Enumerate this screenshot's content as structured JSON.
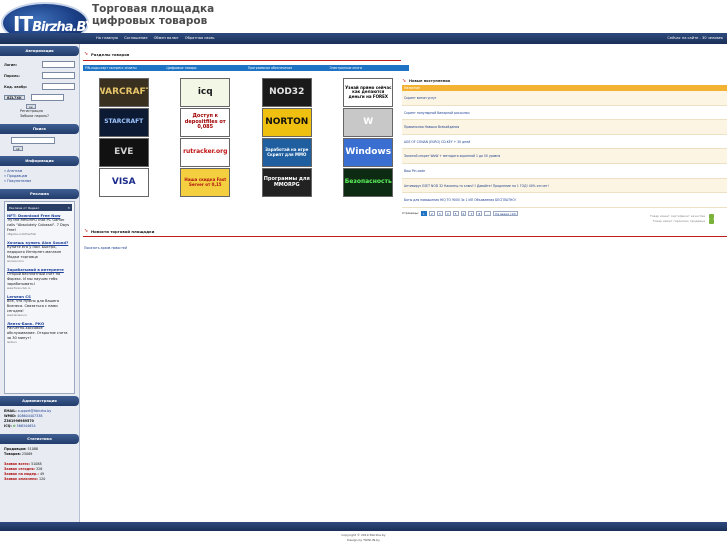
{
  "header": {
    "logo_main": "IT",
    "logo_tail": "Birzha.BY",
    "slogan_line1": "Торговая площадка",
    "slogan_line2": "цифровых товаров"
  },
  "topnav": {
    "items": [
      "На главную",
      "Соглашение",
      "Обмен валют",
      "Обратная связь"
    ],
    "online": "Сейчас на сайте - 30 человек"
  },
  "sidebar": {
    "auth_title": "Авторизация",
    "login_label": "Логин:",
    "password_label": "Пароль:",
    "code_label": "Код. изобр:",
    "captcha_text": "8ZL7XK",
    "submit_label": "ок",
    "register_link": "Регистрация",
    "forgot_link": "Забыли пароль?",
    "search_title": "Поиск",
    "search_button": "ok",
    "info_title": "Информация",
    "info_links": [
      "Агентам",
      "Продавцам",
      "Покупателям"
    ],
    "ads_title": "Реклама",
    "ads_head": "Реклама от Яндекс",
    "ads": [
      {
        "title": "NFT: Download Free Now",
        "text": "Try the MMORPG that PC Gamer calls \"Absolutely Colossal\". 7 Days Free!",
        "url": "nftgame.com/FreeTrial"
      },
      {
        "title": "Хочешь купить Alon Sound?",
        "text": "Купите его у нас! Быстро, недорого Интернет-магазин Модки торговца",
        "url": "alonsound.ru"
      },
      {
        "title": "Зарабатывай в интернете",
        "text": "Открой бесплатный счет на Форекс. И мы научим тебя зарабатывать!",
        "url": "www.forex-club.ru"
      },
      {
        "title": "Lersean CS",
        "text": "Все, что нужно для Вашего бизнеса. Связаться с нами сегодня!",
        "url": "www.lersean.ru"
      },
      {
        "title": "Лента-Банк. РКО",
        "text": "Расчетно-кассовое обслуживание. Открытие счета за 30 минут!",
        "url": "lenta.ru"
      }
    ],
    "admin_title": "Администрация",
    "admin": [
      {
        "label": "EMAIL:",
        "value": "support@itbirzha.by"
      },
      {
        "label": "WMID:",
        "value": "408604407338"
      },
      {
        "label": "Z:",
        "value": "Z361996989570"
      },
      {
        "label": "ICQ:",
        "value": "566344654"
      }
    ],
    "stats_title": "Статистика",
    "stats": [
      {
        "label": "Продавцов:",
        "value": "51088",
        "red": false
      },
      {
        "label": "Товаров:",
        "value": "25069",
        "red": false
      },
      {
        "label": "Заявок всего:",
        "value": "51088",
        "red": true
      },
      {
        "label": "Заявок сегодня:",
        "value": "326",
        "red": true
      },
      {
        "label": "Заявок на модер.:",
        "value": "49",
        "red": true
      },
      {
        "label": "Заявок оплачено:",
        "value": "120",
        "red": true
      }
    ]
  },
  "main": {
    "sections_title": "Разделы товаров",
    "categories": [
      "PIN-коды карт экспресс оплаты",
      "Цифровые товары",
      "Программное обеспечение",
      "Электронные книги"
    ],
    "banners": [
      {
        "text": "WARCRAFT",
        "bg": "#3a3020",
        "fg": "#e7c66a"
      },
      {
        "text": "icq",
        "bg": "#f2f7e6",
        "fg": "#1a1a1a"
      },
      {
        "text": "NOD32",
        "bg": "#1a1a1a",
        "fg": "#e6e6e6"
      },
      {
        "text": "Узнай прямо сейчас как делаются деньги на FOREX",
        "bg": "#ffffff",
        "fg": "#000000"
      },
      {
        "text": "STARCRAFT",
        "bg": "#0d1a33",
        "fg": "#9cc5ff"
      },
      {
        "text": "Доступ к depositfiles от 0,085",
        "bg": "#ffffff",
        "fg": "#a00000"
      },
      {
        "text": "NORTON",
        "bg": "#f0c010",
        "fg": "#111111"
      },
      {
        "text": "W",
        "bg": "#c8c8c8",
        "fg": "#ffffff"
      },
      {
        "text": "EVE",
        "bg": "#111111",
        "fg": "#cfcfcf"
      },
      {
        "text": "rutracker.org",
        "bg": "#ffffff",
        "fg": "#c01010"
      },
      {
        "text": "Заработай на игре Скрипт для MMO",
        "bg": "#1f5fa0",
        "fg": "#ffffff"
      },
      {
        "text": "Windows",
        "bg": "#3a6ed0",
        "fg": "#ffffff"
      },
      {
        "text": "VISA",
        "bg": "#ffffff",
        "fg": "#1a2a8a"
      },
      {
        "text": "Наша скидка Fast Server от 0,15",
        "bg": "#f4d040",
        "fg": "#b01010"
      },
      {
        "text": "Программы для MMORPG",
        "bg": "#222222",
        "fg": "#ffffff"
      },
      {
        "text": "Безопасность",
        "bg": "#0d2a12",
        "fg": "#5df55d"
      }
    ],
    "news_title": "Новые поступления",
    "news_sub": "Название",
    "news": [
      "Скрипт витин услуг",
      "Скрипт популярной бинарной рассылки",
      "Правильная Навыка Всекайдания",
      "AGE OF CONAN (EURO) CD-KEY + 30 дней",
      "Золотой секрет WoW + метадата экранной 1 до 50 уровня",
      "Ваш Pin-code",
      "Антивирус ESET NOD 32 Наконец-то ключ!!! Давайте! Продление на 1 ГОД! 40% отсчет!",
      "Боты для повышения HIQ ТО 9000 3х 1 ИЛ Объявления БЕСПЛАТНО!"
    ],
    "pager_label": "Страницы:",
    "pages": [
      "1",
      "2",
      "3",
      "4",
      "5",
      "6",
      "7",
      "8",
      "...",
      "На вверх (10)"
    ],
    "legend": [
      "Товар имеет сертификат качества",
      "Товар имеет гарантию продавца"
    ],
    "latest_news_title": "Новости торговой площадки",
    "latest_news_link": "Показать архив новостей"
  },
  "footer": {
    "line1": "Copyright © 2010 Itbirzha.by",
    "line2": "Design by TOWI.IN.by"
  }
}
